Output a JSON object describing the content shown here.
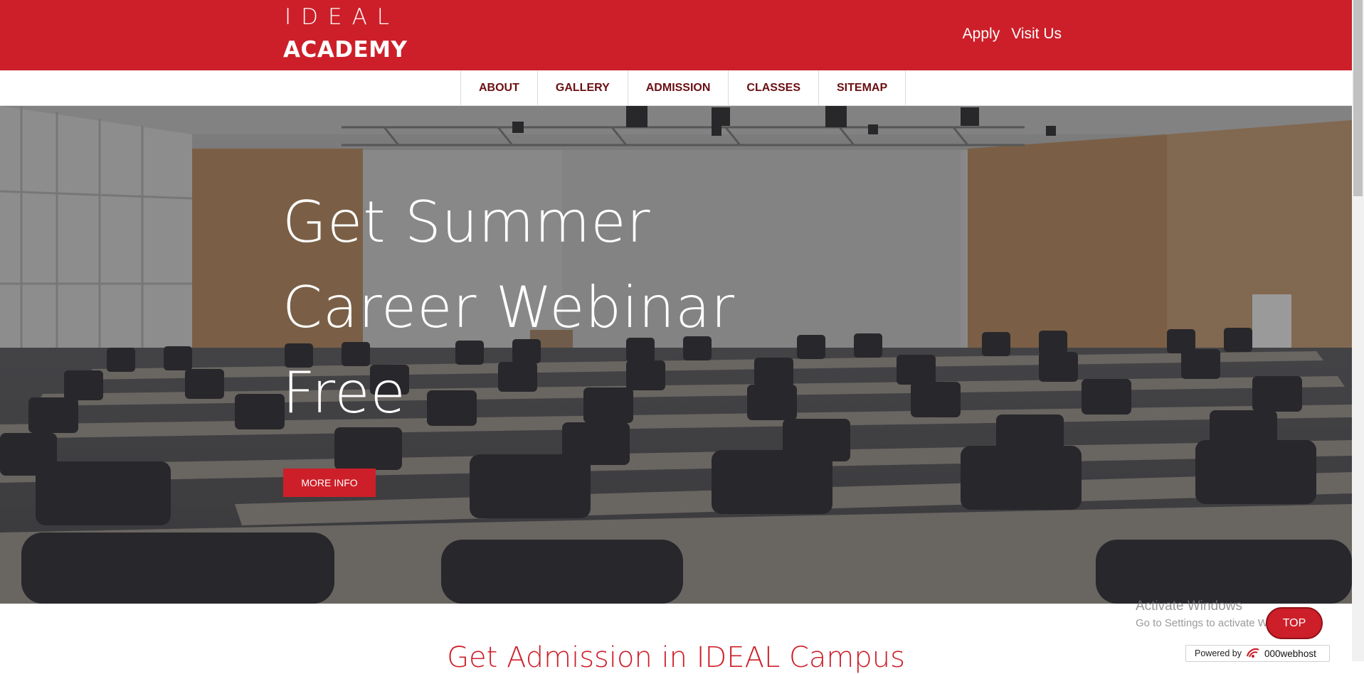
{
  "brand": {
    "line1": "IDEAL",
    "line2": "ACADEMY"
  },
  "top_links": [
    "Apply",
    "Visit Us"
  ],
  "nav": [
    "ABOUT",
    "GALLERY",
    "ADMISSION",
    "CLASSES",
    "SITEMAP"
  ],
  "hero": {
    "title_lines": [
      "Get Summer",
      "Career Webinar",
      "Free"
    ],
    "button": "MORE INFO"
  },
  "section_title": "Get Admission in IDEAL Campus",
  "windows_watermark": {
    "line1": "Activate Windows",
    "line2": "Go to Settings to activate Windows."
  },
  "top_button": "TOP",
  "powered_by": {
    "label": "Powered by",
    "brand": "000webhost"
  },
  "colors": {
    "primary": "#cd1f29",
    "nav_text": "#6b0f12"
  }
}
